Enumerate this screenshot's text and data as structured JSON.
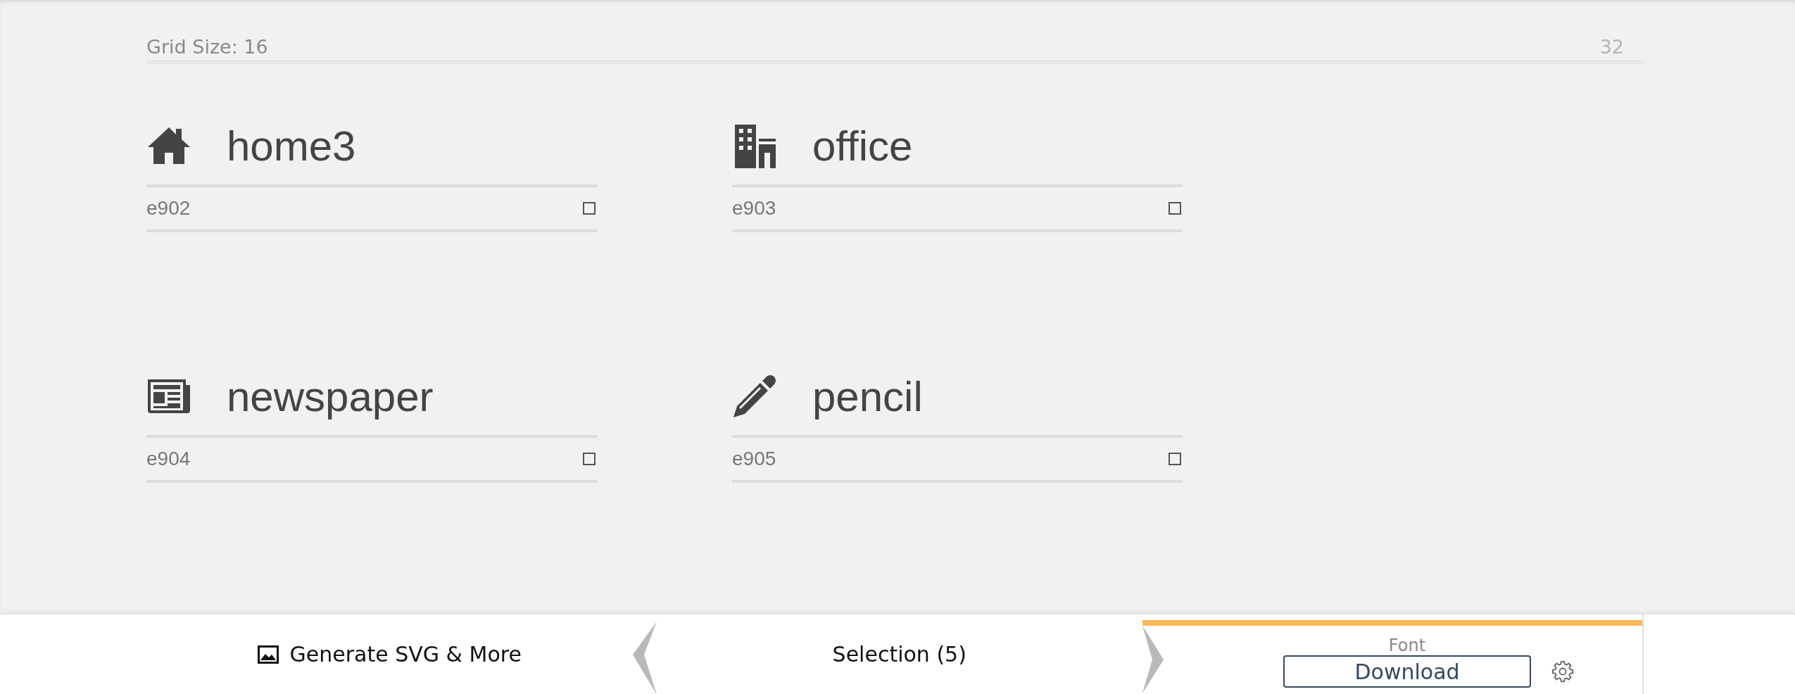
{
  "grid": {
    "label": "Grid Size: 16",
    "max": "32"
  },
  "glyphs": [
    {
      "kind": "home",
      "name": "home3",
      "code": "e902",
      "selected": false
    },
    {
      "kind": "office",
      "name": "office",
      "code": "e903",
      "selected": false
    },
    {
      "kind": "newspaper",
      "name": "newspaper",
      "code": "e904",
      "selected": false
    },
    {
      "kind": "pencil",
      "name": "pencil",
      "code": "e905",
      "selected": false
    }
  ],
  "bottom_bar": {
    "generate": "Generate SVG & More",
    "selection": "Selection (5)",
    "font_label": "Font",
    "download": "Download"
  }
}
